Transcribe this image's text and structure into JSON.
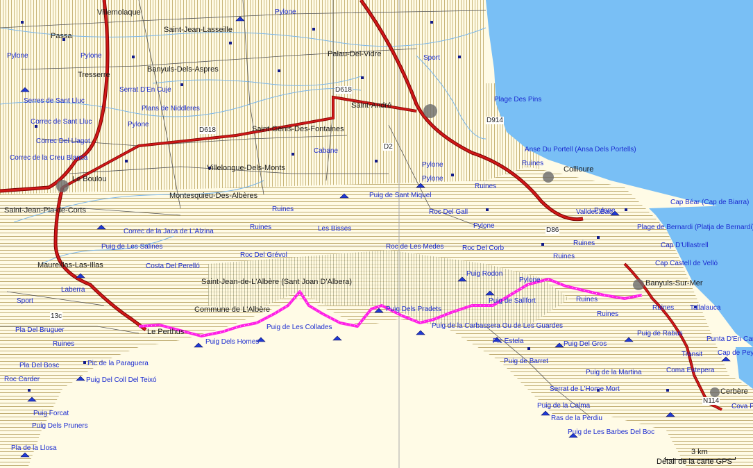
{
  "colors": {
    "sea": "#79bff5",
    "land_hatch": "#d9cf8a",
    "plain": "#fffbe6",
    "road_main": "#d01818",
    "route": "#ff1fe6",
    "poi": "#111a8a",
    "label": "#1b2bd0"
  },
  "towns": [
    {
      "id": "villemolaque",
      "text": "Villemolaque"
    },
    {
      "id": "saint-jean-lasseille",
      "text": "Saint-Jean-Lasseille"
    },
    {
      "id": "passa",
      "text": "Passa"
    },
    {
      "id": "palau-del-vidre",
      "text": "Palau-Del-Vidre"
    },
    {
      "id": "tresserre",
      "text": "Tresserre"
    },
    {
      "id": "banyuls-dels-aspres",
      "text": "Banyuls-Dels-Aspres"
    },
    {
      "id": "saint-andre",
      "text": "Saint-André"
    },
    {
      "id": "saint-genis",
      "text": "Saint-Genis-Des-Fontaines"
    },
    {
      "id": "villelongue",
      "text": "Villelongue-Dels-Monts"
    },
    {
      "id": "le-boulou",
      "text": "Le Boulou"
    },
    {
      "id": "montesquieu",
      "text": "Montesquieu-Des-Albères"
    },
    {
      "id": "saint-jean-pla-de-corts",
      "text": "Saint-Jean-Pla-de-Corts"
    },
    {
      "id": "collioure",
      "text": "Collioure"
    },
    {
      "id": "maureillas",
      "text": "Maureillas-Las-Illas"
    },
    {
      "id": "saint-jean-albere",
      "text": "Saint-Jean-de-L'Albère (Sant Joan D'Albera)"
    },
    {
      "id": "commune-albere",
      "text": "Commune de L'Albère"
    },
    {
      "id": "le-perthus",
      "text": "Le Perthus"
    },
    {
      "id": "banyuls-sur-mer",
      "text": "Banyuls-Sur-Mer"
    },
    {
      "id": "cerbere",
      "text": "Cerbère"
    }
  ],
  "places": [
    {
      "id": "pylone-1",
      "text": "Pylone"
    },
    {
      "id": "pylone-2",
      "text": "Pylone"
    },
    {
      "id": "pylone-3",
      "text": "Pylone"
    },
    {
      "id": "pylone-4",
      "text": "Pylone"
    },
    {
      "id": "pylone-5",
      "text": "Pylone"
    },
    {
      "id": "pylone-6",
      "text": "Pylone"
    },
    {
      "id": "pylone-7",
      "text": "Pylone"
    },
    {
      "id": "pylone-8",
      "text": "Pylone"
    },
    {
      "id": "pylone-9",
      "text": "Pylone"
    },
    {
      "id": "sport-1",
      "text": "Sport"
    },
    {
      "id": "sport-2",
      "text": "Sport"
    },
    {
      "id": "serrat-en-cuje",
      "text": "Serrat D'En Cuje"
    },
    {
      "id": "serres-sant-lluc",
      "text": "Serres de Sant Lluc"
    },
    {
      "id": "plans-niddleres",
      "text": "Plans de Niddleres"
    },
    {
      "id": "plage-des-pins",
      "text": "Plage Des Pins"
    },
    {
      "id": "correc-sant-lluc",
      "text": "Correc de Sant Lluc"
    },
    {
      "id": "correc-del-llagot",
      "text": "Correc Del Llagot"
    },
    {
      "id": "cabane",
      "text": "Cabane"
    },
    {
      "id": "anse-portell",
      "text": "Anse Du Portell (Ansa Dels Portells)"
    },
    {
      "id": "correc-creu-blanca",
      "text": "Correc de la Creu Blanca"
    },
    {
      "id": "ruines-1",
      "text": "Ruines"
    },
    {
      "id": "ruines-2",
      "text": "Ruines"
    },
    {
      "id": "ruines-3",
      "text": "Ruines"
    },
    {
      "id": "ruines-4",
      "text": "Ruines"
    },
    {
      "id": "ruines-5",
      "text": "Ruines"
    },
    {
      "id": "ruines-6",
      "text": "Ruines"
    },
    {
      "id": "ruines-7",
      "text": "Ruines"
    },
    {
      "id": "ruines-8",
      "text": "Ruines"
    },
    {
      "id": "ruines-9",
      "text": "Ruines"
    },
    {
      "id": "ruines-10",
      "text": "Ruines"
    },
    {
      "id": "puig-sant-miquel",
      "text": "Puig de Sant Miquel"
    },
    {
      "id": "roc-del-gall",
      "text": "Roc Del Gall"
    },
    {
      "id": "cap-bear",
      "text": "Cap Béar (Cap de Biarra)"
    },
    {
      "id": "valldes-bac",
      "text": "Valldes Bac"
    },
    {
      "id": "correc-jaca-alzina",
      "text": "Correc de la Jaca de L'Alzina"
    },
    {
      "id": "les-bisses",
      "text": "Les Bisses"
    },
    {
      "id": "plage-bernardi",
      "text": "Plage de Bernardi (Platja de Bernardi)"
    },
    {
      "id": "puig-de-les-salines",
      "text": "Puig de Les Salines"
    },
    {
      "id": "roc-de-les-medes",
      "text": "Roc de Les Medes"
    },
    {
      "id": "roc-del-corb",
      "text": "Roc Del Corb"
    },
    {
      "id": "cap-ullastrell",
      "text": "Cap D'Ullastrell"
    },
    {
      "id": "roc-del-grevol",
      "text": "Roc Del Grévol"
    },
    {
      "id": "costa-perello",
      "text": "Costa Del Perelló"
    },
    {
      "id": "cap-castell-vello",
      "text": "Cap Castell de Velló"
    },
    {
      "id": "puig-rodon",
      "text": "Puig Rodon"
    },
    {
      "id": "puig-sallfort",
      "text": "Puig de Sallfort"
    },
    {
      "id": "puig-dels-pradets",
      "text": "Puig Dels Pradets"
    },
    {
      "id": "tallalauca",
      "text": "Tallalauca"
    },
    {
      "id": "laberra",
      "text": "Laberra"
    },
    {
      "id": "puig-collades",
      "text": "Puig de Les Collades"
    },
    {
      "id": "puig-carbassera",
      "text": "Puig de la Carbassera Ou de Les Guardes"
    },
    {
      "id": "puig-rabus",
      "text": "Puig de Rabus"
    },
    {
      "id": "pla-del-bruguer",
      "text": "Pla Del Bruguer"
    },
    {
      "id": "puig-dels-homes",
      "text": "Puig Dels Homes"
    },
    {
      "id": "pic-estela",
      "text": "Pic Estela"
    },
    {
      "id": "puig-del-gros",
      "text": "Puig Del Gros"
    },
    {
      "id": "punta-en-canadell",
      "text": "Punta D'En Canadell"
    },
    {
      "id": "pla-del-bosc",
      "text": "Pla Del Bosc"
    },
    {
      "id": "pic-paraguera",
      "text": "Pic de la Paraguera"
    },
    {
      "id": "puig-barret",
      "text": "Puig de Barret"
    },
    {
      "id": "cap-de-peyrefite",
      "text": "Cap de Peyrefite"
    },
    {
      "id": "transit",
      "text": "Transit"
    },
    {
      "id": "puig-martina",
      "text": "Puig de la Martina"
    },
    {
      "id": "coma-estepera",
      "text": "Coma Estepera"
    },
    {
      "id": "roc-carder",
      "text": "Roc Carder"
    },
    {
      "id": "puig-coll-teixo",
      "text": "Puig Del Coll Del Teixó"
    },
    {
      "id": "serrat-home-mort",
      "text": "Serrat de L'Home Mort"
    },
    {
      "id": "puig-calma",
      "text": "Puig de la Calma"
    },
    {
      "id": "puig-forcat",
      "text": "Puig Forcat"
    },
    {
      "id": "ras-perdiu",
      "text": "Ras de la Perdiu"
    },
    {
      "id": "cova-pepa",
      "text": "Cova Pepa"
    },
    {
      "id": "puig-pruners",
      "text": "Puig Dels Pruners"
    },
    {
      "id": "puig-barbes-boc",
      "text": "Puig de Les Barbes Del Boc"
    },
    {
      "id": "pla-de-la-llosa",
      "text": "Pla de la Llosa"
    }
  ],
  "roads": [
    {
      "id": "d2",
      "text": "D2"
    },
    {
      "id": "d618",
      "text": "D618"
    },
    {
      "id": "d618b",
      "text": "D618"
    },
    {
      "id": "d914",
      "text": "D914"
    },
    {
      "id": "d86",
      "text": "D86"
    },
    {
      "id": "n114",
      "text": "N114"
    },
    {
      "id": "d13c",
      "text": "13c"
    }
  ],
  "scale": {
    "distance": "3 km",
    "caption": "Détail de la carte GPS"
  }
}
